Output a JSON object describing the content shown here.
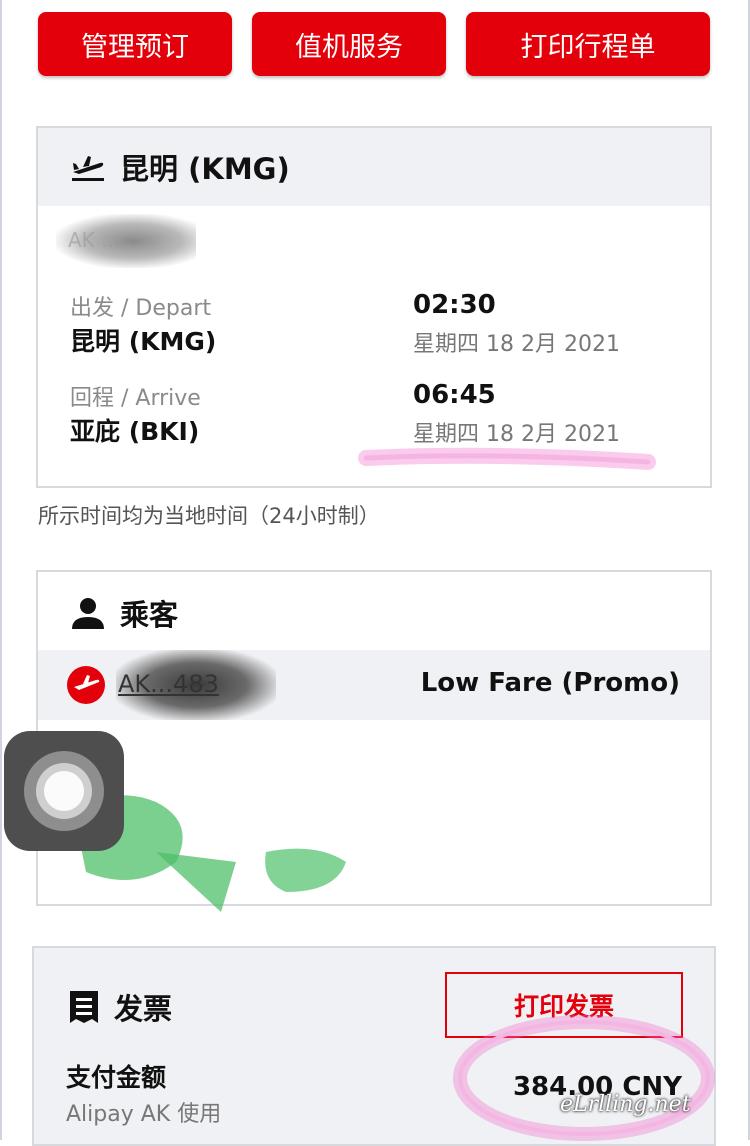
{
  "actions": {
    "manage_label": "管理预订",
    "checkin_label": "值机服务",
    "print_itinerary_label": "打印行程单"
  },
  "flight": {
    "title": "昆明 (KMG)",
    "redacted_code": "AK ...",
    "depart": {
      "label": "出发 / Depart",
      "city": "昆明 (KMG)",
      "time": "02:30",
      "date": "星期四 18 2月 2021"
    },
    "arrive": {
      "label": "回程 / Arrive",
      "city": "亚庇 (BKI)",
      "time": "06:45",
      "date": "星期四 18 2月 2021"
    },
    "note": "所示时间均为当地时间（24小时制）"
  },
  "passenger": {
    "title": "乘客",
    "booking_ref": "AK...483",
    "fare": "Low Fare (Promo)"
  },
  "invoice": {
    "title": "发票",
    "print_label": "打印发票",
    "amount_label": "支付金额",
    "method": "Alipay AK 使用",
    "amount": "384.00 CNY"
  },
  "watermark": "eLrlling.net",
  "colors": {
    "brand_red": "#e3000b",
    "panel_grey": "#f0f1f4",
    "highlight_pink": "#f06bc8"
  },
  "icons": {
    "depart": "airplane-takeoff-icon",
    "passenger": "person-icon",
    "airline_logo": "airline-logo-icon",
    "invoice": "receipt-icon",
    "assistive_touch": "assistive-touch-icon"
  }
}
